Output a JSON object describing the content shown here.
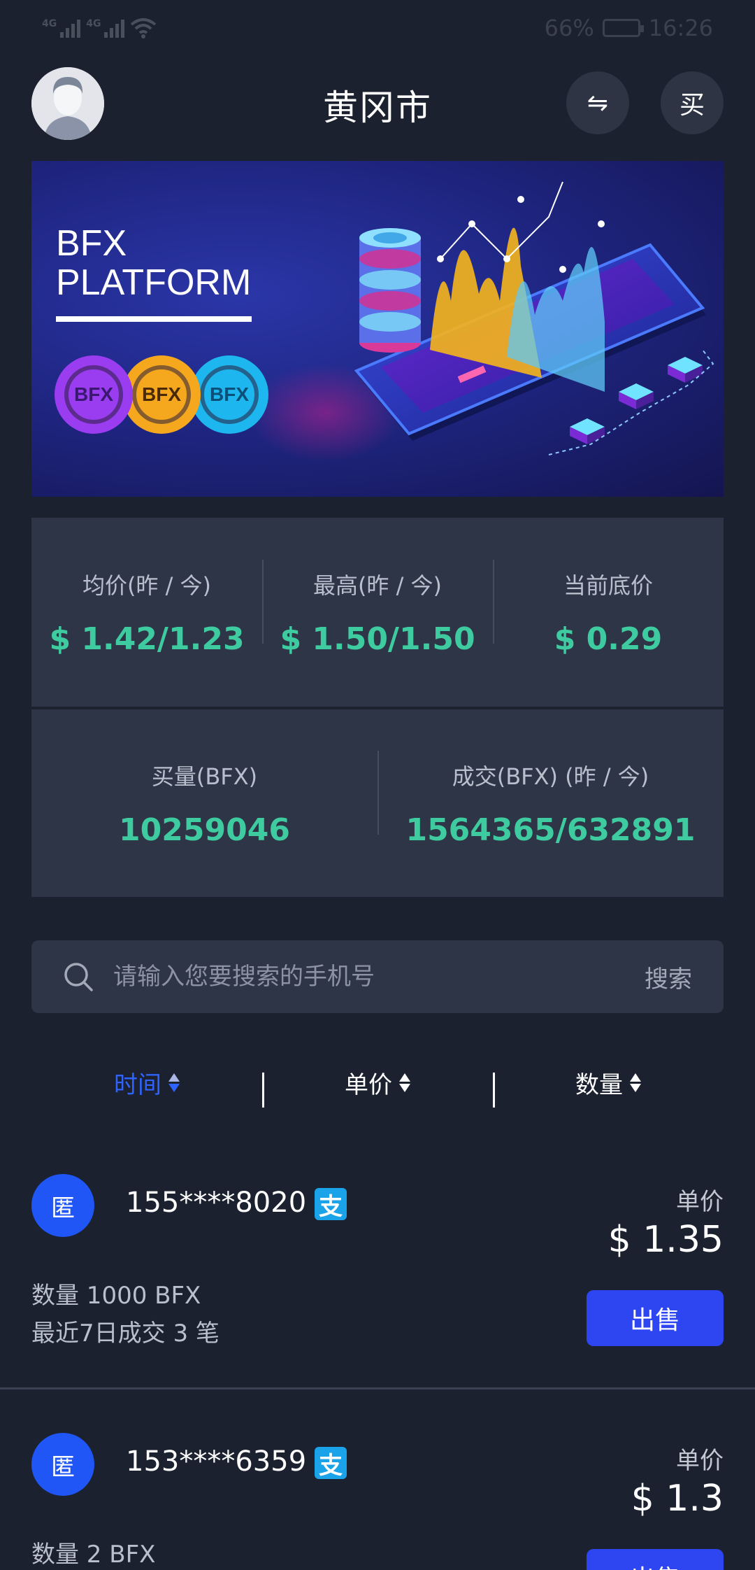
{
  "status_bar": {
    "network1": "4G",
    "network2": "4G",
    "battery": "66%",
    "battery_level": 0.66,
    "time": "16:26"
  },
  "header": {
    "title": "黄冈市",
    "swap_icon": "⇋",
    "buy_label": "买"
  },
  "banner": {
    "line1": "BFX",
    "line2": "PLATFORM",
    "coins": [
      "BFX",
      "BFX",
      "BFX"
    ]
  },
  "stats": [
    {
      "label": "均价(昨 / 今)",
      "value": "$ 1.42/1.23"
    },
    {
      "label": "最高(昨 / 今)",
      "value": "$ 1.50/1.50"
    },
    {
      "label": "当前底价",
      "value": "$ 0.29"
    }
  ],
  "stats2": [
    {
      "label": "买量(BFX)",
      "value": "10259046"
    },
    {
      "label": "成交(BFX) (昨 / 今)",
      "value": "1564365/632891"
    }
  ],
  "search": {
    "placeholder": "请输入您要搜索的手机号",
    "button": "搜索"
  },
  "sort": [
    {
      "label": "时间",
      "active": true
    },
    {
      "label": "单价",
      "active": false
    },
    {
      "label": "数量",
      "active": false
    }
  ],
  "listings": [
    {
      "avatar_text": "匿",
      "phone": "155****8020",
      "pay_icon": "支",
      "unit_label": "单价",
      "price": "$ 1.35",
      "quantity": "数量 1000 BFX",
      "recent": "最近7日成交 3 笔",
      "action": "出售"
    },
    {
      "avatar_text": "匿",
      "phone": "153****6359",
      "pay_icon": "支",
      "unit_label": "单价",
      "price": "$ 1.3",
      "quantity": "数量 2 BFX",
      "action": "出售"
    }
  ]
}
